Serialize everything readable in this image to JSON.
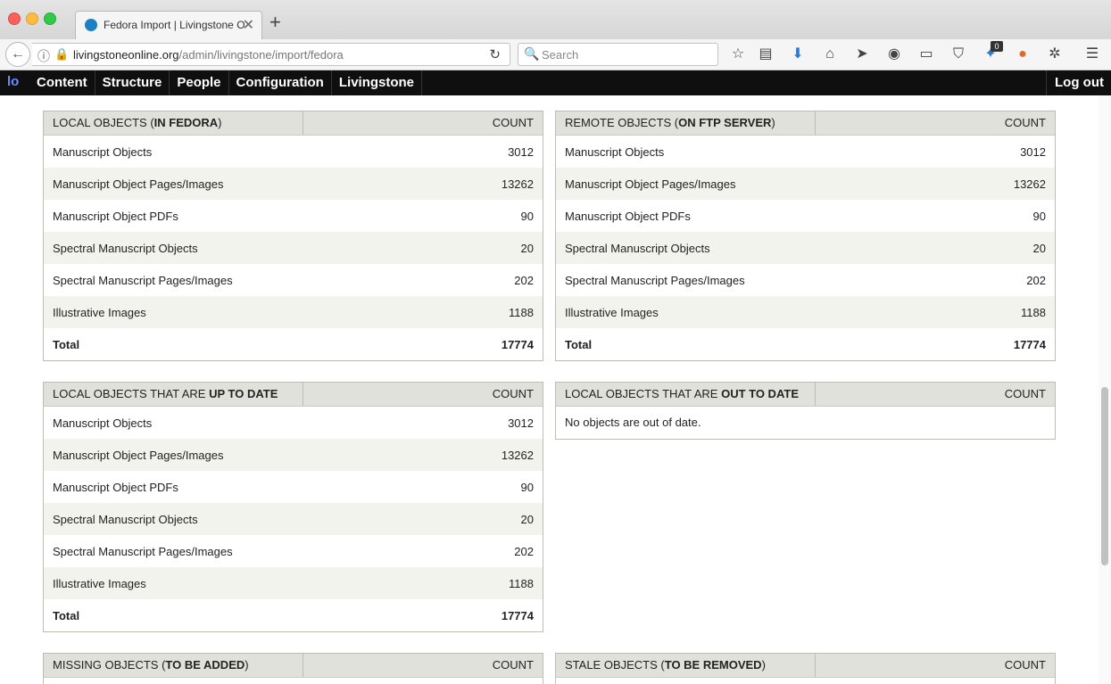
{
  "browser": {
    "tab_title": "Fedora Import | Livingstone O",
    "url_domain": "livingstoneonline.org",
    "url_path": "/admin/livingstone/import/fedora",
    "search_placeholder": "Search",
    "badge_count": "0"
  },
  "admin_toolbar": {
    "menu": [
      "Content",
      "Structure",
      "People",
      "Configuration",
      "Livingstone"
    ],
    "logout": "Log out"
  },
  "panels": {
    "local_fedora": {
      "title_prefix": "LOCAL OBJECTS (",
      "title_bold": "IN FEDORA",
      "title_suffix": ")",
      "count_label": "COUNT",
      "rows": [
        {
          "label": "Manuscript Objects",
          "value": "3012"
        },
        {
          "label": "Manuscript Object Pages/Images",
          "value": "13262"
        },
        {
          "label": "Manuscript Object PDFs",
          "value": "90"
        },
        {
          "label": "Spectral Manuscript Objects",
          "value": "20"
        },
        {
          "label": "Spectral Manuscript Pages/Images",
          "value": "202"
        },
        {
          "label": "Illustrative Images",
          "value": "1188"
        }
      ],
      "total": {
        "label": "Total",
        "value": "17774"
      }
    },
    "remote_ftp": {
      "title_prefix": "REMOTE OBJECTS (",
      "title_bold": "ON FTP SERVER",
      "title_suffix": ")",
      "count_label": "COUNT",
      "rows": [
        {
          "label": "Manuscript Objects",
          "value": "3012"
        },
        {
          "label": "Manuscript Object Pages/Images",
          "value": "13262"
        },
        {
          "label": "Manuscript Object PDFs",
          "value": "90"
        },
        {
          "label": "Spectral Manuscript Objects",
          "value": "20"
        },
        {
          "label": "Spectral Manuscript Pages/Images",
          "value": "202"
        },
        {
          "label": "Illustrative Images",
          "value": "1188"
        }
      ],
      "total": {
        "label": "Total",
        "value": "17774"
      }
    },
    "up_to_date": {
      "title_prefix": "LOCAL OBJECTS THAT ARE ",
      "title_bold": "UP TO DATE",
      "title_suffix": "",
      "count_label": "COUNT",
      "rows": [
        {
          "label": "Manuscript Objects",
          "value": "3012"
        },
        {
          "label": "Manuscript Object Pages/Images",
          "value": "13262"
        },
        {
          "label": "Manuscript Object PDFs",
          "value": "90"
        },
        {
          "label": "Spectral Manuscript Objects",
          "value": "20"
        },
        {
          "label": "Spectral Manuscript Pages/Images",
          "value": "202"
        },
        {
          "label": "Illustrative Images",
          "value": "1188"
        }
      ],
      "total": {
        "label": "Total",
        "value": "17774"
      }
    },
    "out_to_date": {
      "title_prefix": "LOCAL OBJECTS THAT ARE ",
      "title_bold": "OUT TO DATE",
      "title_suffix": "",
      "count_label": "COUNT",
      "empty_message": "No objects are out of date."
    },
    "missing": {
      "title_prefix": "MISSING OBJECTS (",
      "title_bold": "TO BE ADDED",
      "title_suffix": ")",
      "count_label": "COUNT"
    },
    "stale": {
      "title_prefix": "STALE OBJECTS (",
      "title_bold": "TO BE REMOVED",
      "title_suffix": ")",
      "count_label": "COUNT"
    }
  }
}
